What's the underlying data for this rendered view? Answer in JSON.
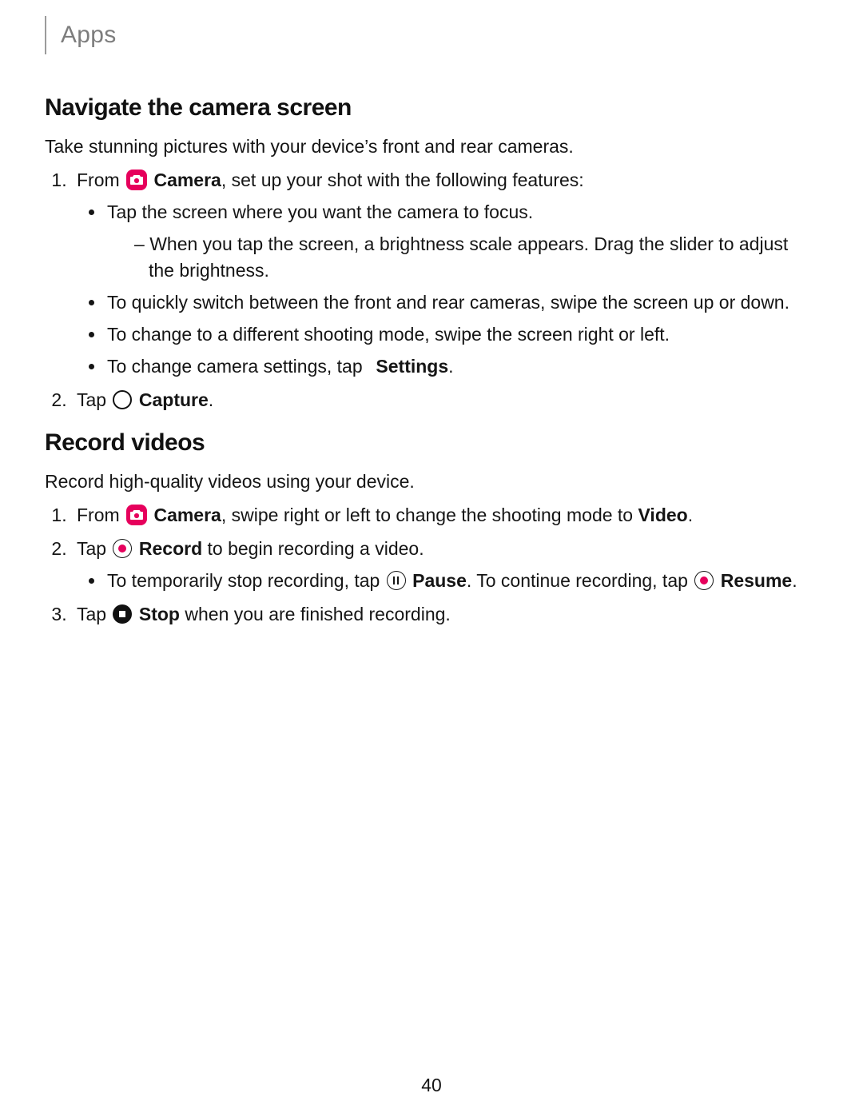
{
  "header": {
    "title": "Apps"
  },
  "page_number": "40",
  "labels": {
    "camera": "Camera",
    "settings": "Settings",
    "capture": "Capture",
    "video": "Video",
    "record": "Record",
    "pause": "Pause",
    "resume": "Resume",
    "stop": "Stop"
  },
  "section1": {
    "heading": "Navigate the camera screen",
    "intro": "Take stunning pictures with your device’s front and rear cameras.",
    "step1_lead": "From ",
    "step1_tail": ", set up your shot with the following features:",
    "b1": "Tap the screen where you want the camera to focus.",
    "b1_sub1": "When you tap the screen, a brightness scale appears. Drag the slider to adjust the brightness.",
    "b2": "To quickly switch between the front and rear cameras, swipe the screen up or down.",
    "b3": "To change to a different shooting mode, swipe the screen right or left.",
    "b4_lead": "To change camera settings, tap ",
    "b4_tail": ".",
    "step2_lead": "Tap ",
    "step2_tail": "."
  },
  "section2": {
    "heading": "Record videos",
    "intro": "Record high-quality videos using your device.",
    "step1_lead": "From ",
    "step1_mid": ", swipe right or left to change the shooting mode to ",
    "step1_tail": ".",
    "step2_lead": "Tap ",
    "step2_tail": " to begin recording a video.",
    "b1_lead": "To temporarily stop recording, tap ",
    "b1_mid": ". To continue recording, tap ",
    "b1_tail": ".",
    "step3_lead": "Tap ",
    "step3_tail": " when you are finished recording."
  }
}
